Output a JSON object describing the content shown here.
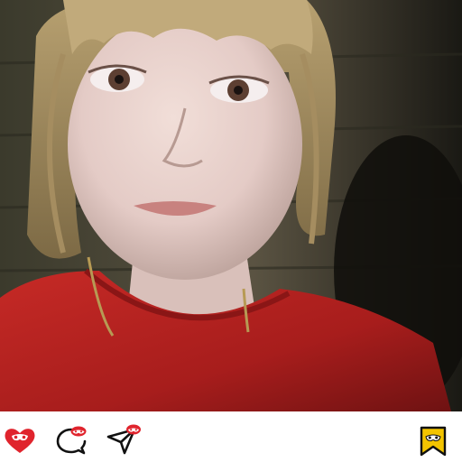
{
  "post": {
    "photo_description": "",
    "actions": {
      "like": {
        "icon": "heart-icon",
        "badge_icon": "mask-icon",
        "color": "#e0242d"
      },
      "comment": {
        "icon": "comment-bubble-icon",
        "badge_icon": "mask-icon",
        "color": "#e0242d"
      },
      "share": {
        "icon": "paper-plane-icon",
        "badge_icon": "mask-icon",
        "color": "#e0242d"
      },
      "save": {
        "icon": "bookmark-icon",
        "badge_icon": "mask-icon",
        "color": "#f3c400"
      }
    }
  }
}
